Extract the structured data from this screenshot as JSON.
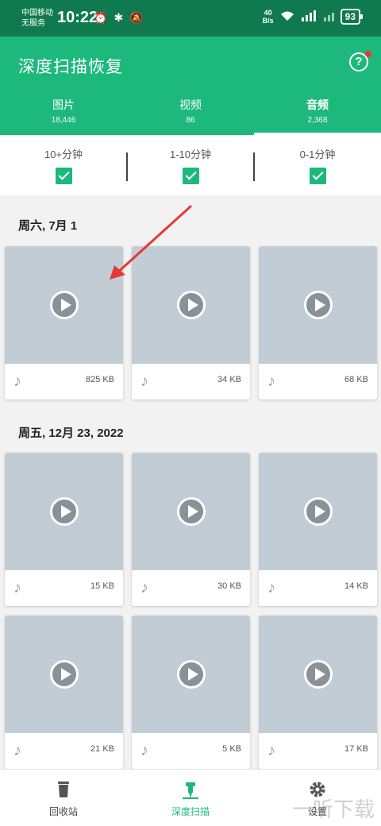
{
  "status_bar": {
    "carrier_line1": "中国移动",
    "carrier_line2": "无服务",
    "time": "10:22",
    "net_speed_value": "40",
    "net_speed_unit": "B/s",
    "battery": "93"
  },
  "header": {
    "title": "深度扫描恢复",
    "help_icon": "?"
  },
  "tabs": [
    {
      "label": "图片",
      "count": "18,446"
    },
    {
      "label": "视频",
      "count": "86"
    },
    {
      "label": "音频",
      "count": "2,368",
      "active": true
    }
  ],
  "filters": [
    {
      "label": "10+分钟",
      "checked": true
    },
    {
      "label": "1-10分钟",
      "checked": true
    },
    {
      "label": "0-1分钟",
      "checked": true
    }
  ],
  "sections": [
    {
      "date": "周六, 7月 1",
      "items": [
        {
          "size": "825 KB"
        },
        {
          "size": "34 KB"
        },
        {
          "size": "68 KB"
        }
      ]
    },
    {
      "date": "周五, 12月 23, 2022",
      "items": [
        {
          "size": "15 KB"
        },
        {
          "size": "30 KB"
        },
        {
          "size": "14 KB"
        },
        {
          "size": "21 KB"
        },
        {
          "size": "5 KB"
        },
        {
          "size": "17 KB"
        }
      ]
    }
  ],
  "bottom_nav": [
    {
      "label": "回收站",
      "icon": "trash-icon"
    },
    {
      "label": "深度扫描",
      "icon": "drill-icon",
      "active": true
    },
    {
      "label": "设置",
      "icon": "gear-icon"
    }
  ],
  "watermark": "一听下载",
  "colors": {
    "accent": "#1db97c",
    "status_bar": "#0f7a4d",
    "thumb": "#c2ccd5",
    "annotation_arrow": "#e53935"
  }
}
